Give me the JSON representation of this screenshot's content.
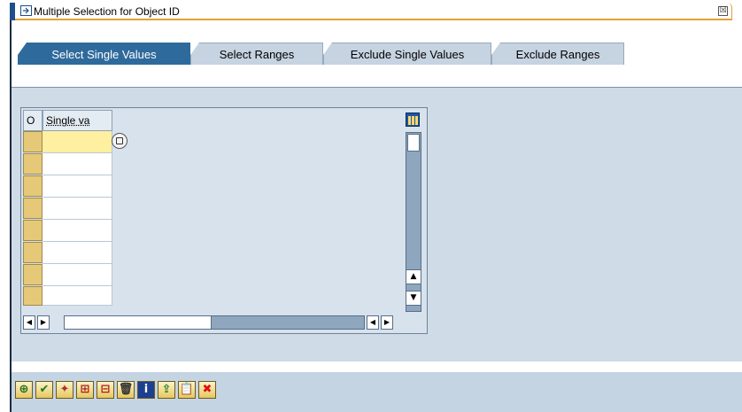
{
  "dialog": {
    "title": "Multiple Selection for Object ID",
    "close_glyph": "☒"
  },
  "tabs": [
    {
      "label": "Select Single Values",
      "active": true
    },
    {
      "label": "Select Ranges",
      "active": false
    },
    {
      "label": "Exclude Single Values",
      "active": false
    },
    {
      "label": "Exclude Ranges",
      "active": false
    }
  ],
  "table": {
    "columns": [
      "O",
      "Single va"
    ],
    "rows": [
      "",
      "",
      "",
      "",
      "",
      "",
      "",
      ""
    ]
  },
  "scroll": {
    "up": "▲",
    "down": "▼",
    "left": "◀",
    "right": "▶"
  },
  "toolbar": [
    {
      "name": "execute-icon",
      "glyph": "⊕",
      "color": "#1d6b1d"
    },
    {
      "name": "copy-check-icon",
      "glyph": "✔",
      "color": "#1f7a1f"
    },
    {
      "name": "import-icon",
      "glyph": "✦",
      "color": "#a33"
    },
    {
      "name": "insert-line-icon",
      "glyph": "⊞",
      "color": "#b01c1c"
    },
    {
      "name": "delete-line-icon",
      "glyph": "⊟",
      "color": "#b01c1c"
    },
    {
      "name": "delete-all-icon",
      "glyph": "🗑",
      "color": "#333"
    },
    {
      "name": "help-icon",
      "glyph": "i",
      "color": "#ffffff"
    },
    {
      "name": "upload-icon",
      "glyph": "⇪",
      "color": "#1f7a1f"
    },
    {
      "name": "paste-icon",
      "glyph": "📋",
      "color": "#7a5a10"
    },
    {
      "name": "cancel-icon",
      "glyph": "✖",
      "color": "#d11"
    }
  ]
}
